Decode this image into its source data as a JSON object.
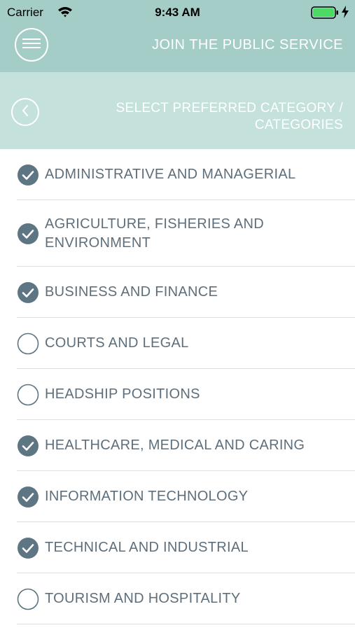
{
  "status_bar": {
    "carrier": "Carrier",
    "time": "9:43 AM",
    "battery_color": "#4cd964"
  },
  "header": {
    "title": "JOIN THE PUBLIC SERVICE",
    "menu_icon": "hamburger-icon"
  },
  "subheader": {
    "title": "SELECT PREFERRED CATEGORY / CATEGORIES",
    "back_icon": "chevron-left-icon"
  },
  "colors": {
    "header_bg": "#a4cdc7",
    "subheader_bg": "#c5e1dc",
    "check_fill": "#5e7583",
    "text": "#5e6f7b"
  },
  "categories": [
    {
      "label": "ADMINISTRATIVE AND MANAGERIAL",
      "checked": true
    },
    {
      "label": "AGRICULTURE, FISHERIES AND ENVIRONMENT",
      "checked": true
    },
    {
      "label": "BUSINESS AND FINANCE",
      "checked": true
    },
    {
      "label": "COURTS AND LEGAL",
      "checked": false
    },
    {
      "label": "HEADSHIP POSITIONS",
      "checked": false
    },
    {
      "label": "HEALTHCARE, MEDICAL AND CARING",
      "checked": true
    },
    {
      "label": "INFORMATION TECHNOLOGY",
      "checked": true
    },
    {
      "label": "TECHNICAL AND INDUSTRIAL",
      "checked": true
    },
    {
      "label": "TOURISM AND HOSPITALITY",
      "checked": false
    }
  ]
}
